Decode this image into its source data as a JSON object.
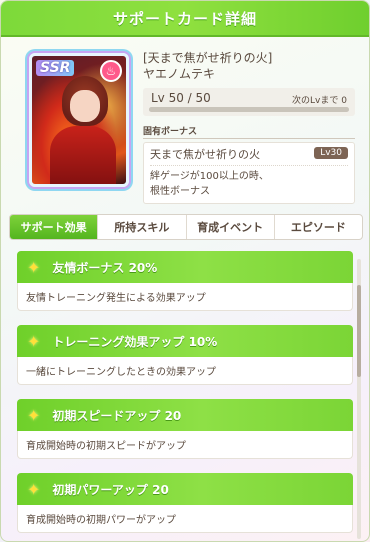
{
  "header": {
    "title": "サポートカード詳細"
  },
  "card": {
    "rarity": "SSR",
    "type_icon": "fire-flame-icon",
    "title": "[天まで焦がせ祈りの火]",
    "character": "ヤエノムテキ",
    "level_label": "Lv 50 / 50",
    "next_lv_label": "次のLvまで",
    "next_lv_value": "0",
    "level_progress": 1.0
  },
  "bonus": {
    "section_label": "固有ボーナス",
    "name": "天まで焦がせ祈りの火",
    "level": "Lv30",
    "desc_line1": "絆ゲージが100以上の時、",
    "desc_line2": "根性ボーナス"
  },
  "tabs": [
    {
      "label": "サポート効果",
      "active": true
    },
    {
      "label": "所持スキル",
      "active": false
    },
    {
      "label": "育成イベント",
      "active": false
    },
    {
      "label": "エピソード",
      "active": false
    }
  ],
  "effects": [
    {
      "title": "友情ボーナス 20%",
      "desc": "友情トレーニング発生による効果アップ"
    },
    {
      "title": "トレーニング効果アップ 10%",
      "desc": "一緒にトレーニングしたときの効果アップ"
    },
    {
      "title": "初期スピードアップ 20",
      "desc": "育成開始時の初期スピードがアップ"
    },
    {
      "title": "初期パワーアップ 20",
      "desc": "育成開始時の初期パワーがアップ"
    }
  ],
  "colors": {
    "accent_green": "#6fd02a",
    "bonus_lv_bg": "#7d6454"
  }
}
